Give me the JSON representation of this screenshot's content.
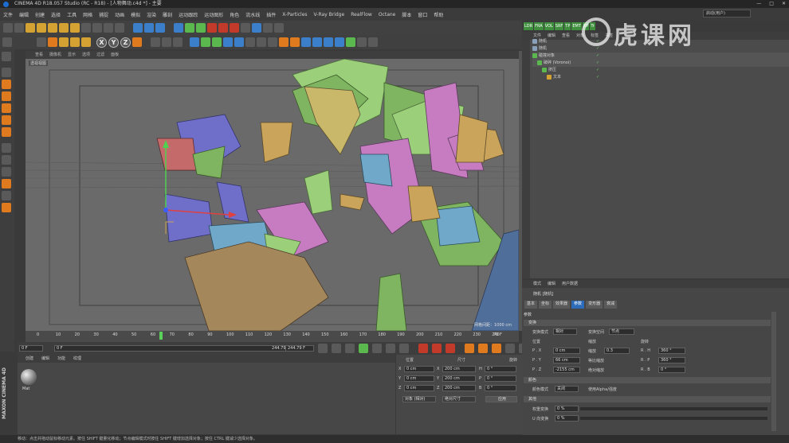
{
  "window": {
    "title": "CINEMA 4D R18.057 Studio (RC - R18) - [人物舞动.c4d *] - 主要"
  },
  "menu": [
    "文件",
    "编辑",
    "创建",
    "选择",
    "工具",
    "网格",
    "捕捉",
    "动画",
    "模拟",
    "渲染",
    "雕刻",
    "运动跟踪",
    "运动图形",
    "角色",
    "流水线",
    "插件",
    "X-Particles",
    "V-Ray Bridge",
    "RealFlow",
    "Octane",
    "脚本",
    "窗口",
    "帮助"
  ],
  "layout": {
    "label": "界面",
    "value": "启动(用户)"
  },
  "toolbar2": {
    "x": "X",
    "y": "Y",
    "z": "Z"
  },
  "viewport": {
    "menu": [
      "查看",
      "摄像机",
      "显示",
      "选项",
      "过滤",
      "面板"
    ],
    "label": "透视视图",
    "grid_note": "网格间距：1000 cm"
  },
  "timeline": {
    "ticks": [
      "0",
      "10",
      "20",
      "30",
      "40",
      "50",
      "60",
      "70",
      "80",
      "90",
      "100",
      "110",
      "120",
      "130",
      "140",
      "150",
      "160",
      "170",
      "180",
      "190",
      "200",
      "210",
      "220",
      "230",
      "240"
    ],
    "current": "73",
    "end_label": "73 F",
    "frame_start": "0 F",
    "frame_cur": "0 F",
    "frame_end": "244.79 F",
    "frame_end2": "244.79 F"
  },
  "material": {
    "menu": [
      "创建",
      "编辑",
      "功能",
      "纹理"
    ],
    "item": "Mat"
  },
  "coords": {
    "headers": [
      "位置",
      "尺寸",
      "旋转"
    ],
    "rows": [
      {
        "axis": "X",
        "pos": "0 cm",
        "size": "200 cm",
        "rot_label": "H",
        "rot": "0 °"
      },
      {
        "axis": "Y",
        "pos": "0 cm",
        "size": "200 cm",
        "rot_label": "P",
        "rot": "0 °"
      },
      {
        "axis": "Z",
        "pos": "0 cm",
        "size": "200 cm",
        "rot_label": "B",
        "rot": "0 °"
      }
    ],
    "mode1": "对象 (相对)",
    "mode2": "绝对尺寸",
    "apply": "应用"
  },
  "objects": {
    "render_tags": [
      "LDR",
      "FRA",
      "VOL",
      "SRF",
      "TP",
      "EMT",
      "XP",
      "Tr"
    ],
    "menu": [
      "文件",
      "编辑",
      "查看",
      "对象",
      "标签",
      "书签"
    ],
    "rows": [
      {
        "name": "随机",
        "indent": 0,
        "color": "#8aa0b8"
      },
      {
        "name": "随机",
        "indent": 0,
        "color": "#8aa0b8"
      },
      {
        "name": "碰撞对象",
        "indent": 0,
        "color": "#5ab84e"
      },
      {
        "name": "破碎 (Voronoi)",
        "indent": 1,
        "color": "#5ab84e"
      },
      {
        "name": "挤压",
        "indent": 2,
        "color": "#5ab84e"
      },
      {
        "name": "文本",
        "indent": 3,
        "color": "#d4a233"
      }
    ]
  },
  "attributes": {
    "menu": [
      "模式",
      "编辑",
      "用户数据"
    ],
    "object": "随机 [随机]",
    "tabs": [
      "基本",
      "坐标",
      "效果器",
      "参数",
      "变形器",
      "衰减"
    ],
    "active_tab": "参数",
    "section_params": "参数",
    "section_transform": "变换",
    "transform_mode_label": "变换模式",
    "transform_mode": "相对",
    "transform_space_label": "变换空间",
    "transform_space": "节点",
    "pos_label": "位置",
    "scale_label": "缩放",
    "rot_label": "旋转",
    "p": [
      {
        "k": "P . X",
        "v": "0 cm"
      },
      {
        "k": "P . Y",
        "v": "66 cm"
      },
      {
        "k": "P . Z",
        "v": "-2155 cm"
      }
    ],
    "scale": "0.3",
    "uniform_label": "等比缩放",
    "abs_label": "绝对缩放",
    "r": [
      {
        "k": "R . H",
        "v": "360 °"
      },
      {
        "k": "R . P",
        "v": "360 °"
      },
      {
        "k": "R . B",
        "v": "0 °"
      }
    ],
    "section_color": "颜色",
    "color_mode_label": "颜色模式",
    "color_mode": "关闭",
    "use_alpha_label": "使用Alpha/强度",
    "section_other": "其他",
    "weight_label": "权重变换",
    "weight": "0 %",
    "u_label": "U 向变换",
    "u": "0 %"
  },
  "status": "移动：点击并拖动鼠标移动元素。按住 SHIFT 键量化移动；节点编辑模式时按住 SHIFT 键增加选择对象；按住 CTRL 键减少选择对象。",
  "maxon": "MAXON CINEMA 4D",
  "watermark": "虎课网"
}
